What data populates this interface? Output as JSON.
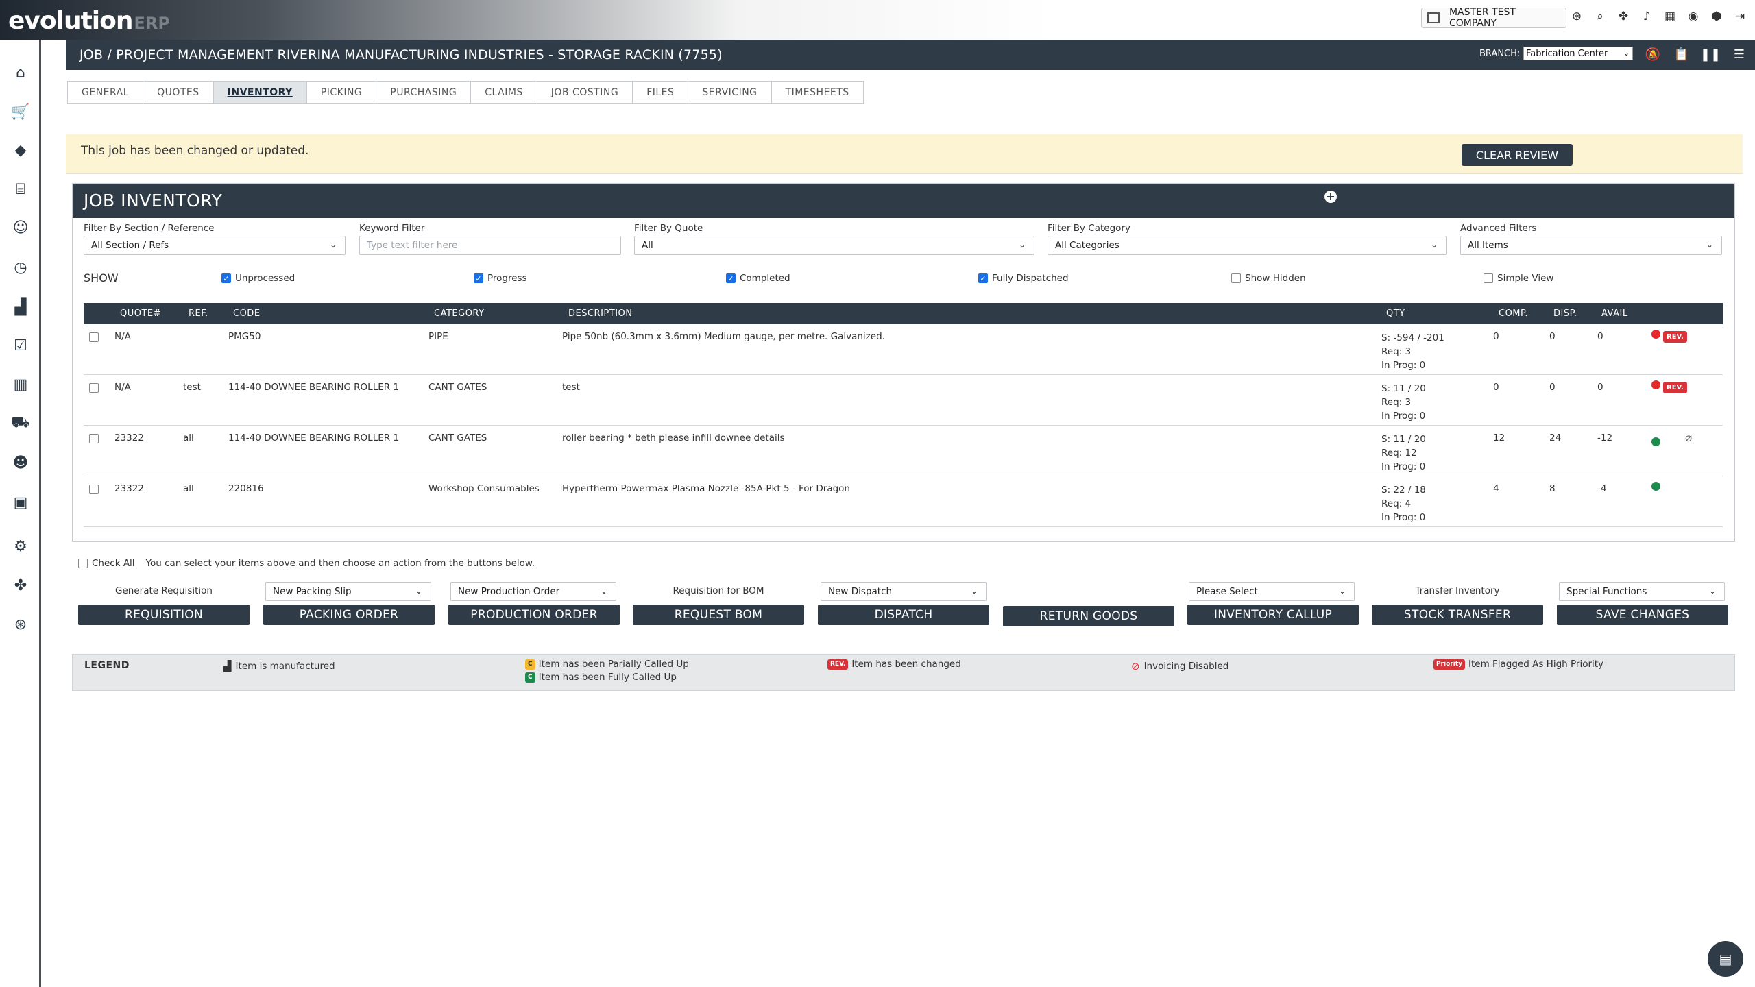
{
  "app": {
    "logo_main": "evolution",
    "logo_sub": "ERP",
    "company": "MASTER TEST COMPANY"
  },
  "titlebar": {
    "title": "JOB / PROJECT MANAGEMENT RIVERINA MANUFACTURING INDUSTRIES - STORAGE RACKIN (7755)",
    "branch_label": "BRANCH:",
    "branch_value": "Fabrication Center"
  },
  "tabs": [
    {
      "label": "GENERAL"
    },
    {
      "label": "QUOTES"
    },
    {
      "label": "INVENTORY"
    },
    {
      "label": "PICKING"
    },
    {
      "label": "PURCHASING"
    },
    {
      "label": "CLAIMS"
    },
    {
      "label": "JOB COSTING"
    },
    {
      "label": "FILES"
    },
    {
      "label": "SERVICING"
    },
    {
      "label": "TIMESHEETS"
    }
  ],
  "banner": {
    "message": "This job has been changed or updated.",
    "clear_label": "CLEAR REVIEW"
  },
  "inventory": {
    "title": "JOB INVENTORY",
    "add_icon": "+",
    "filters": {
      "section_label": "Filter By Section / Reference",
      "section_value": "All Section / Refs",
      "keyword_label": "Keyword Filter",
      "keyword_placeholder": "Type text filter here",
      "quote_label": "Filter By Quote",
      "quote_value": "All",
      "category_label": "Filter By Category",
      "category_value": "All Categories",
      "advanced_label": "Advanced Filters",
      "advanced_value": "All Items"
    },
    "show": {
      "label": "SHOW",
      "options": [
        {
          "label": "Unprocessed",
          "checked": true
        },
        {
          "label": "Progress",
          "checked": true
        },
        {
          "label": "Completed",
          "checked": true
        },
        {
          "label": "Fully Dispatched",
          "checked": true
        },
        {
          "label": "Show Hidden",
          "checked": false
        },
        {
          "label": "Simple View",
          "checked": false
        }
      ]
    },
    "columns": {
      "quote": "QUOTE#",
      "ref": "REF.",
      "code": "CODE",
      "category": "CATEGORY",
      "description": "DESCRIPTION",
      "qty": "QTY",
      "comp": "COMP.",
      "disp": "DISP.",
      "avail": "AVAIL"
    },
    "rows": [
      {
        "quote": "N/A",
        "ref": "",
        "code": "PMG50",
        "category": "PIPE",
        "description": "Pipe 50nb (60.3mm x 3.6mm) Medium gauge, per metre. Galvanized.",
        "qty_s": "S: -594 / -201",
        "qty_req": "Req: 3",
        "qty_prog": "In Prog: 0",
        "comp": "0",
        "disp": "0",
        "avail": "0",
        "status": "red",
        "badge": "REV."
      },
      {
        "quote": "N/A",
        "ref": "test",
        "code": "114-40 DOWNEE BEARING ROLLER 1",
        "category": "CANT GATES",
        "description": "test",
        "qty_s": "S: 11 / 20",
        "qty_req": "Req: 3",
        "qty_prog": "In Prog: 0",
        "comp": "0",
        "disp": "0",
        "avail": "0",
        "status": "red",
        "badge": "REV."
      },
      {
        "quote": "23322",
        "ref": "all",
        "code": "114-40 DOWNEE BEARING ROLLER 1",
        "category": "CANT GATES",
        "description": "roller bearing * beth please infill downee details",
        "qty_s": "S: 11 / 20",
        "qty_req": "Req: 12",
        "qty_prog": "In Prog: 0",
        "comp": "12",
        "disp": "24",
        "avail": "-12",
        "status": "green",
        "badge": ""
      },
      {
        "quote": "23322",
        "ref": "all",
        "code": "220816",
        "category": "Workshop Consumables",
        "description": "Hypertherm Powermax Plasma Nozzle -85A-Pkt 5 - For Dragon",
        "qty_s": "S: 22 / 18",
        "qty_req": "Req: 4",
        "qty_prog": "In Prog: 0",
        "comp": "4",
        "disp": "8",
        "avail": "-4",
        "status": "green",
        "badge": ""
      }
    ]
  },
  "actions": {
    "check_all": "Check All",
    "hint": "You can select your items above and then choose an action from the buttons below.",
    "groups": [
      {
        "label": "Generate Requisition",
        "button": "REQUISITION"
      },
      {
        "select": "New Packing Slip",
        "button": "PACKING ORDER"
      },
      {
        "select": "New Production Order",
        "button": "PRODUCTION ORDER"
      },
      {
        "label": "Requisition for BOM",
        "button": "REQUEST BOM"
      },
      {
        "select": "New Dispatch",
        "button": "DISPATCH"
      },
      {
        "button": "RETURN GOODS"
      },
      {
        "select": "Please Select",
        "button": "INVENTORY CALLUP"
      },
      {
        "label": "Transfer Inventory",
        "button": "STOCK TRANSFER"
      },
      {
        "select": "Special Functions",
        "button": "SAVE CHANGES"
      }
    ]
  },
  "legend": {
    "title": "LEGEND",
    "manufactured": "Item is manufactured",
    "partial_badge": "C",
    "partial": "Item has been Parially Called Up",
    "full_badge": "C",
    "full": "Item has been Fully Called Up",
    "changed_badge": "REV.",
    "changed": "Item has been changed",
    "invoicing": "Invoicing Disabled",
    "priority_badge": "Priority",
    "priority": "Item Flagged As High Priority"
  },
  "colors": {
    "header": "#2f3b47",
    "banner": "#fdf4d3",
    "danger": "#d9333a",
    "success": "#1d8a4e",
    "checkbox": "#1a6ee8"
  }
}
